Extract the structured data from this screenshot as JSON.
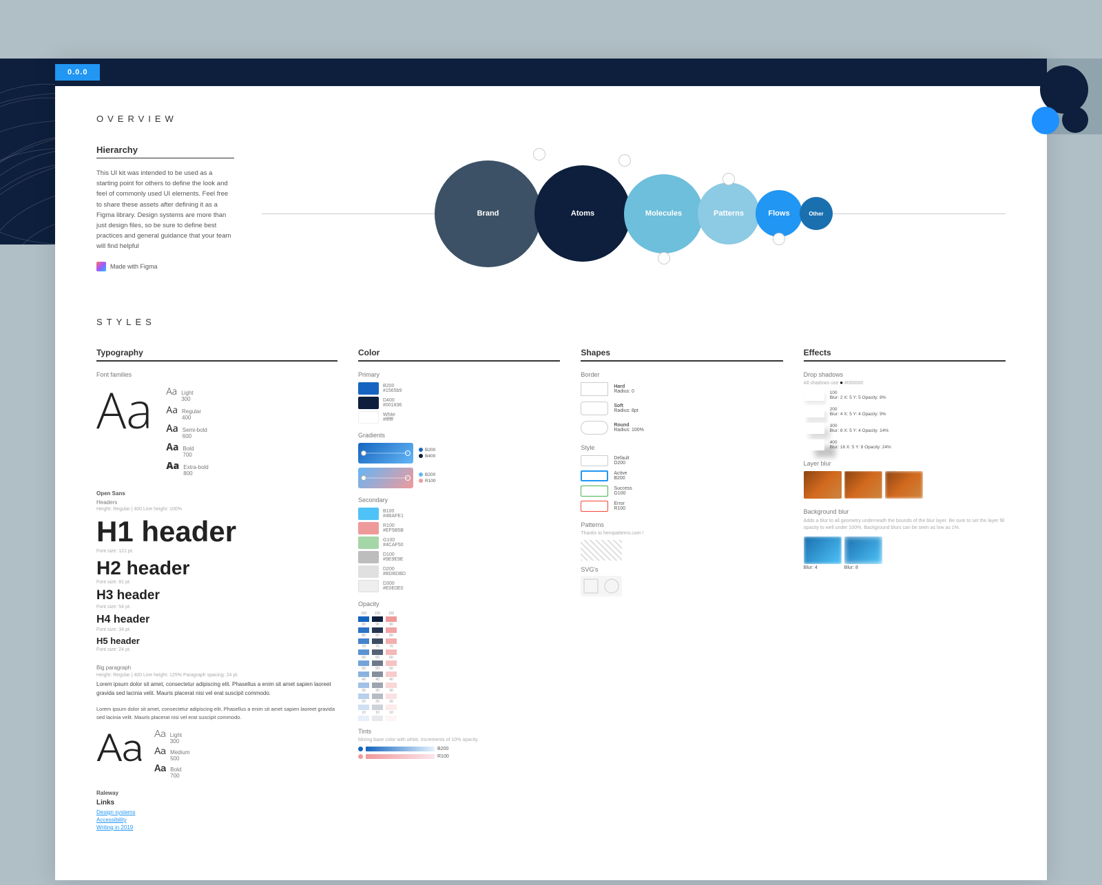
{
  "app": {
    "version": "0.0.0",
    "bg_note": "topography background with circles"
  },
  "overview": {
    "title": "OVERVIEW",
    "hierarchy": {
      "label": "Hierarchy",
      "description": "This UI kit was intended to be used as a starting point for others to define the look and feel of commonly used UI elements. Feel free to share these assets after defining it as a Figma library. Design systems are more than just design files, so be sure to define best practices and general guidance that your team will find helpful",
      "made_with": "Made with Figma",
      "circles": [
        {
          "label": "Brand",
          "size": "lg",
          "color": "#3d5166"
        },
        {
          "label": "Atoms",
          "size": "lg2",
          "color": "#0d1f3c"
        },
        {
          "label": "Molecules",
          "size": "md",
          "color": "#6dbfdb"
        },
        {
          "label": "Patterns",
          "size": "sm",
          "color": "#8dcae3"
        },
        {
          "label": "Flows",
          "size": "xs",
          "color": "#2196F3"
        },
        {
          "label": "Other",
          "size": "xxs",
          "color": "#1a6faf"
        }
      ]
    }
  },
  "styles": {
    "title": "STYLES",
    "typography": {
      "label": "Typography",
      "font_families": "Font families",
      "open_sans": {
        "name": "Open Sans",
        "variants": [
          {
            "weight": "Light",
            "num": "300"
          },
          {
            "weight": "Regular",
            "num": "400"
          },
          {
            "weight": "Semi-bold",
            "num": "600"
          },
          {
            "weight": "Bold",
            "num": "700"
          },
          {
            "weight": "Extra-bold",
            "num": "800"
          }
        ]
      },
      "raleway": {
        "name": "Raleway",
        "variants": [
          {
            "weight": "Light",
            "num": "300"
          },
          {
            "weight": "Medium",
            "num": "500"
          },
          {
            "weight": "Bold",
            "num": "700"
          }
        ]
      },
      "headers_label": "Headers",
      "headers_sub": "Height: Regular | 400   Line height: 100%",
      "h1": {
        "label": "H1 header",
        "size": "Font size: 121 pt."
      },
      "h2": {
        "label": "H2 header",
        "size": "Font size: 81 pt."
      },
      "h3": {
        "label": "H3 header",
        "size": "Font size: 54 pt."
      },
      "h4": {
        "label": "H4 header",
        "size": "Font size: 34 pt."
      },
      "h5": {
        "label": "H5 header",
        "size": "Font size: 24 pt."
      },
      "body_label": "Big paragraph",
      "body_sub": "Height: Regular | 400   Line height: 125%   Paragraph spacing: 24 pt.",
      "body_text": "Lorem ipsum dolor sit amet, consectetur adipiscing elit. Phasellus a enim sit amet sapien laoreet gravida sed lacinia velit. Mauris placerat nisi vel erat suscipit commodo.",
      "small_para_label": "",
      "small_para_text": "Lorem ipsum dolor sit amet, consectetur adipiscing elit. Phasellus a enim sit amet sapien laoreet gravida sed lacinia velit. Mauris placerat nisi vel erat suscipit commodo.",
      "links_label": "Links",
      "links": [
        "Design systems",
        "Accessibility",
        "Writing in 2019"
      ]
    },
    "color": {
      "label": "Color",
      "primary_label": "Primary",
      "primary_swatches": [
        {
          "color": "#1565C0",
          "code": "B200",
          "hex": "#1565b9"
        },
        {
          "color": "#0d47a1",
          "code": "D400",
          "hex": "#001836"
        },
        {
          "color": "#ffffff",
          "code": "White",
          "hex": "#ffffff"
        }
      ],
      "gradients_label": "Gradients",
      "gradients": [
        {
          "from": "#1976D2",
          "to": "#64B5F6",
          "stops": [
            {
              "label": "B200",
              "color": "#1565C0"
            },
            {
              "label": "B400",
              "color": "#0d47a1"
            }
          ]
        },
        {
          "from": "#64B5F6",
          "to": "#ef9a9a",
          "stops": [
            {
              "label": "B200",
              "color": "#64B5F6"
            },
            {
              "label": "R100",
              "color": "#ef9a9a"
            }
          ]
        }
      ],
      "secondary_label": "Secondary",
      "secondary_swatches": [
        {
          "color": "#4fc3f7",
          "code": "B100",
          "hex": "#4BAFE1"
        },
        {
          "color": "#ef9a9a",
          "code": "R100",
          "hex": "#EF5B5B"
        },
        {
          "color": "#a5d6a7",
          "code": "G100",
          "hex": "#4CAF50"
        },
        {
          "color": "#bdbdbd",
          "code": "D100",
          "hex": "#9E9E9E"
        },
        {
          "color": "#e0e0e0",
          "code": "D200",
          "hex": "#BDBDBD"
        },
        {
          "color": "#eeeeee",
          "code": "D300",
          "hex": "#E0E0E0"
        }
      ],
      "opacity_label": "Opacity",
      "tints_label": "Tints",
      "tints_desc": "Mixing base color with white. Increments of 10% opacity.",
      "tint_items": [
        {
          "color": "#1565C0",
          "label": "B200"
        },
        {
          "color": "#ef9a9a",
          "label": "R100"
        }
      ]
    },
    "shapes": {
      "label": "Shapes",
      "border_label": "Border",
      "border_items": [
        {
          "name": "Hard",
          "sub": "Radius: 0"
        },
        {
          "name": "Soft",
          "sub": "Radius: 8pt"
        },
        {
          "name": "Round",
          "sub": "Radius: 100%"
        }
      ],
      "style_label": "Style",
      "style_items": [
        {
          "name": "Default",
          "code": "D200",
          "class": "default"
        },
        {
          "name": "Active",
          "code": "B200",
          "class": "active"
        },
        {
          "name": "Success",
          "code": "G100",
          "class": "success"
        },
        {
          "name": "Error",
          "code": "R100",
          "class": "error"
        }
      ],
      "patterns_label": "Patterns",
      "patterns_sub": "Thanks to heropatterns.com !",
      "svgs_label": "SVG's"
    },
    "effects": {
      "label": "Effects",
      "drop_shadows_label": "Drop shadows",
      "drop_shadows_sub": "All shadows use ● #000000",
      "shadows": [
        {
          "label": "100",
          "sub": "Blur: 2   X: 5   Y: 5   Opacity: 8%"
        },
        {
          "label": "200",
          "sub": "Blur: 4   X: 5   Y: 4   Opacity: 9%"
        },
        {
          "label": "300",
          "sub": "Blur: 8   X: 5   Y: 4   Opacity: 14%"
        },
        {
          "label": "400",
          "sub": "Blur: 16   X: 5   Y: 8   Opacity: 24%"
        }
      ],
      "layer_blur_label": "Layer blur",
      "bg_blur_label": "Background blur",
      "bg_blur_desc": "Adds a blur to all geometry underneath the bounds of the blur layer. Be sure to set the layer fill opacity to well under 100%. Background blurs can be seen as low as 1%.",
      "bg_blur_items": [
        {
          "name": "Blur: 4"
        },
        {
          "name": "Blur: 8"
        }
      ]
    }
  }
}
